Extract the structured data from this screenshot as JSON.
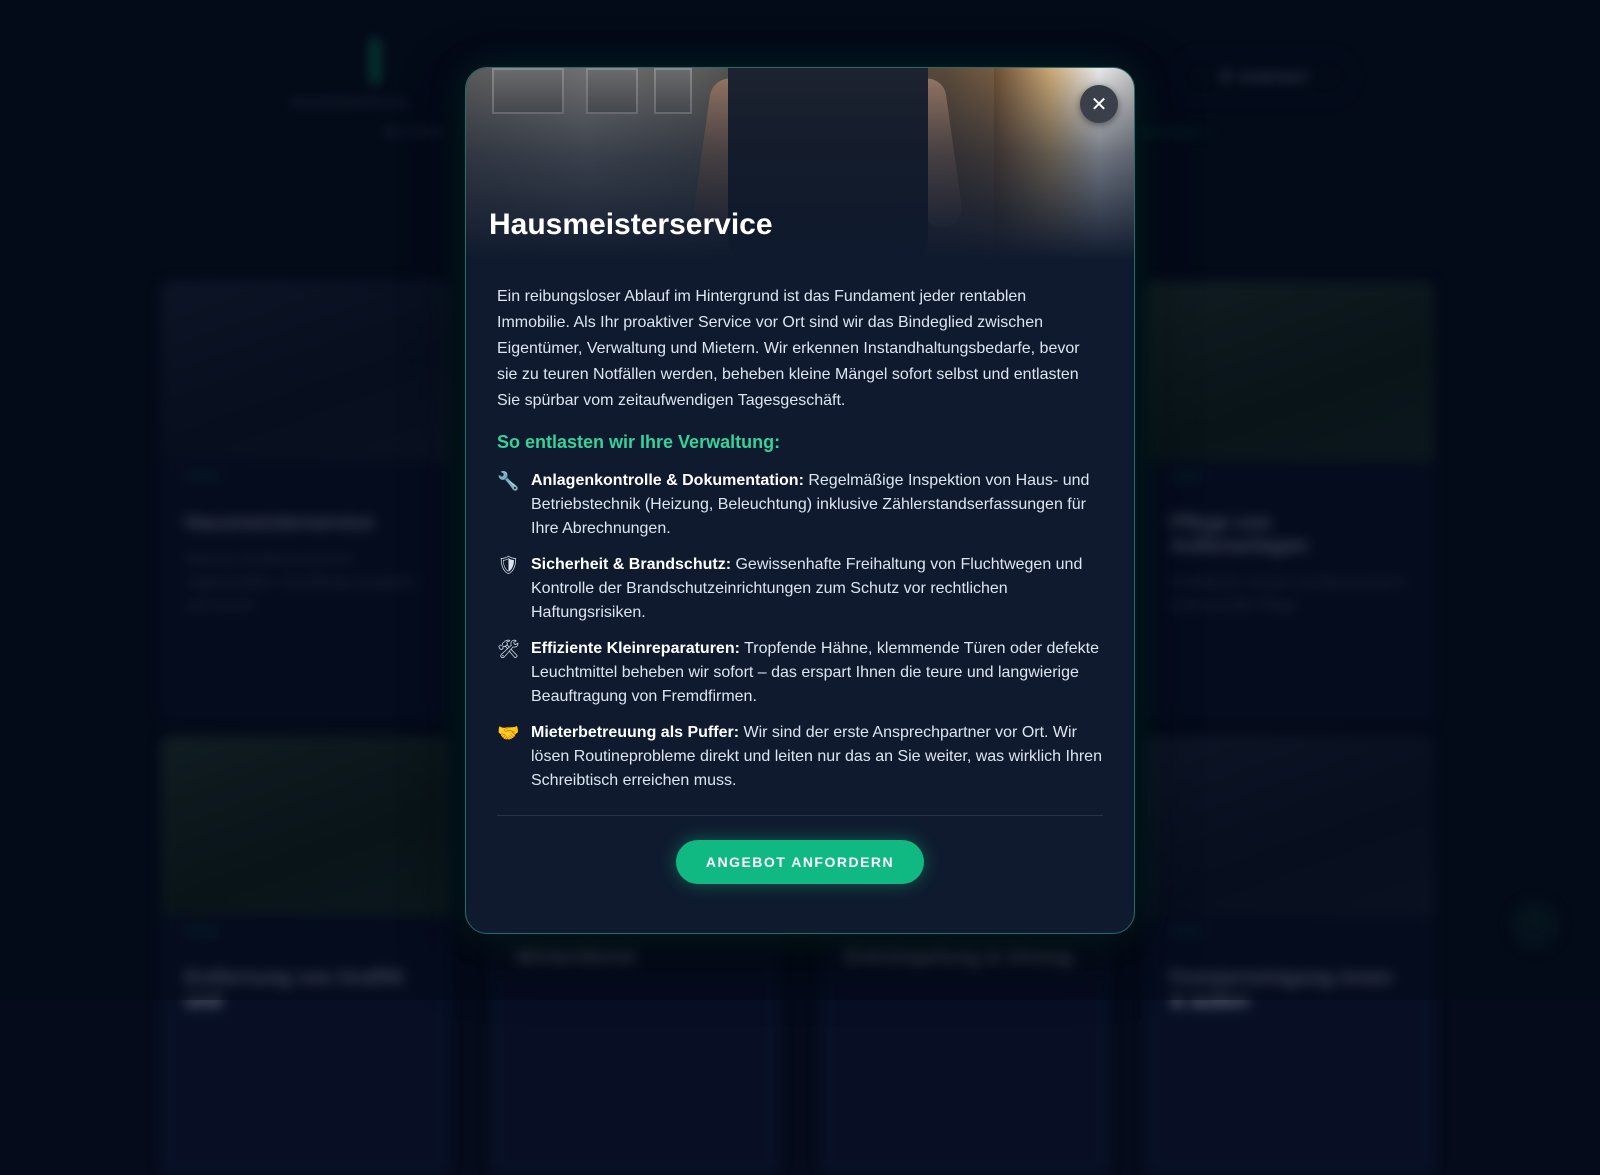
{
  "background": {
    "logo_text": "WAGNERSERVICE",
    "nav_left": "Tipps & Blog",
    "nav_right": "Jetzt buchen ↗",
    "contact_label": "KONTAKT",
    "contact_icon": "phone-icon",
    "cards": [
      {
        "tag": "Service",
        "title": "Hausmeisterservice",
        "text": "Wartung und Betreuung Ihrer Liegenschaften. Zuverlässig, kompetent und ortsnah."
      },
      {
        "tag": "Service",
        "title": "Pflege von Außenanlagen",
        "text": "Grünflächen, Hecken und Baumschnitt in professioneller Pflege."
      },
      {
        "tag": "Service",
        "title": "Entfernung von Graffiti und",
        "text": ""
      },
      {
        "tag": "",
        "title": "Winterdienst",
        "text": ""
      },
      {
        "tag": "",
        "title": "Entrümpelung & Umzug",
        "text": ""
      },
      {
        "tag": "Service",
        "title": "Fensterreinigung innen & außen",
        "text": ""
      }
    ]
  },
  "modal": {
    "title": "Hausmeisterservice",
    "close_icon": "close-icon",
    "intro": "Ein reibungsloser Ablauf im Hintergrund ist das Fundament jeder rentablen Immobilie. Als Ihr proaktiver Service vor Ort sind wir das Bindeglied zwischen Eigentümer, Verwaltung und Mietern. Wir erkennen Instandhaltungsbedarfe, bevor sie zu teuren Notfällen werden, beheben kleine Mängel sofort selbst und entlasten Sie spürbar vom zeitaufwendigen Tagesgeschäft.",
    "sub_heading": "So entlasten wir Ihre Verwaltung:",
    "features": [
      {
        "icon": "🔧",
        "icon_name": "wrench-icon",
        "strong": "Anlagenkontrolle & Dokumentation:",
        "text": " Regelmäßige Inspektion von Haus- und Betriebstechnik (Heizung, Beleuchtung) inklusive Zählerstandserfassungen für Ihre Abrechnungen."
      },
      {
        "icon": "🛡",
        "icon_name": "shield-icon",
        "strong": "Sicherheit & Brandschutz:",
        "text": " Gewissenhafte Freihaltung von Fluchtwegen und Kontrolle der Brandschutzeinrichtungen zum Schutz vor rechtlichen Haftungsrisiken."
      },
      {
        "icon": "🛠",
        "icon_name": "tools-icon",
        "strong": "Effiziente Kleinreparaturen:",
        "text": " Tropfende Hähne, klemmende Türen oder defekte Leuchtmittel beheben wir sofort – das erspart Ihnen die teure und langwierige Beauftragung von Fremdfirmen."
      },
      {
        "icon": "🤝",
        "icon_name": "handshake-icon",
        "strong": "Mieterbetreuung als Puffer:",
        "text": " Wir sind der erste Ansprechpartner vor Ort. Wir lösen Routineprobleme direkt und leiten nur das an Sie weiter, was wirklich Ihren Schreibtisch erreichen muss."
      }
    ],
    "cta_label": "ANGEBOT ANFORDERN",
    "colors": {
      "accent": "#10b981",
      "accent_text": "#34d399",
      "modal_bg": "#0f1a2e",
      "page_bg": "#050b1a"
    }
  }
}
